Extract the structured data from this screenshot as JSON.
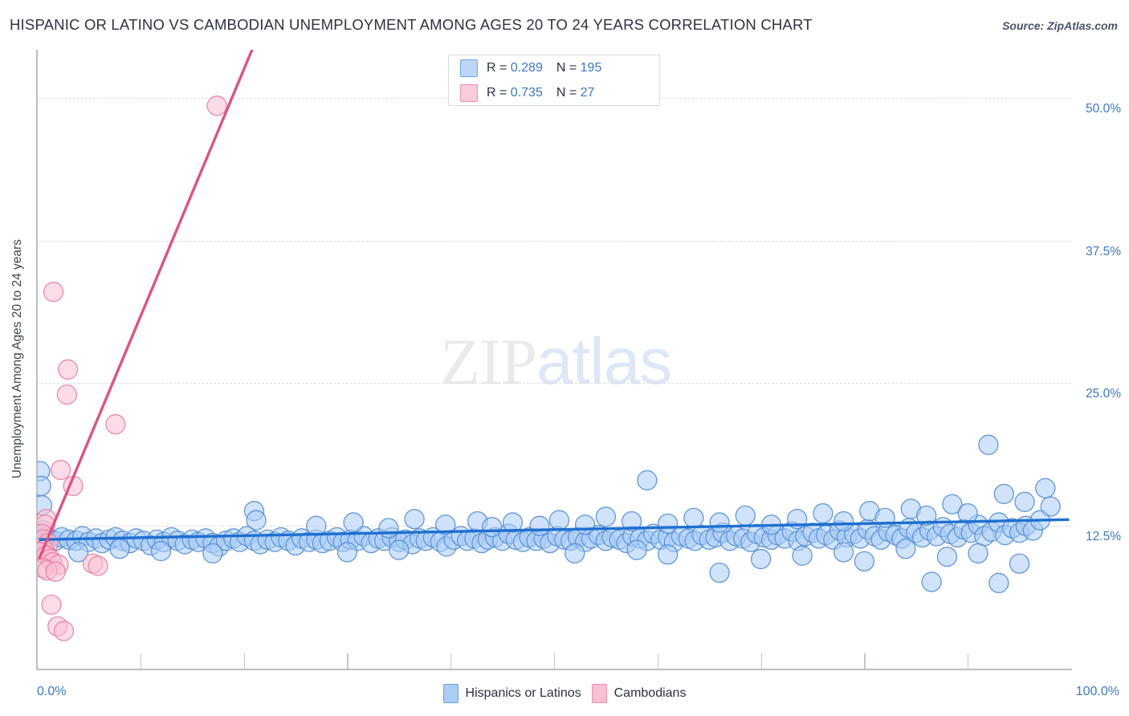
{
  "header": {
    "title": "HISPANIC OR LATINO VS CAMBODIAN UNEMPLOYMENT AMONG AGES 20 TO 24 YEARS CORRELATION CHART",
    "source": "Source: ZipAtlas.com"
  },
  "watermark": {
    "part1": "ZIP",
    "part2": "atlas"
  },
  "stats": {
    "rows": [
      {
        "series": "Hispanics or Latinos",
        "r_label": "R =",
        "r_value": "0.289",
        "n_label": "N =",
        "n_value": "195",
        "color": "#bdd6f7"
      },
      {
        "series": "Cambodians",
        "r_label": "R =",
        "r_value": "0.735",
        "n_label": "N =",
        "n_value": "27",
        "color": "#f9ccd9"
      }
    ]
  },
  "legend": {
    "items": [
      {
        "label": "Hispanics or Latinos",
        "color": "#aaccf5",
        "border": "#6fa3e0"
      },
      {
        "label": "Cambodians",
        "color": "#f9c0d2",
        "border": "#eb90ad"
      }
    ]
  },
  "chart_data": {
    "type": "scatter",
    "title": "HISPANIC OR LATINO VS CAMBODIAN UNEMPLOYMENT AMONG AGES 20 TO 24 YEARS CORRELATION CHART",
    "xlabel": "",
    "ylabel": "Unemployment Among Ages 20 to 24 years",
    "xlim": [
      0,
      100
    ],
    "ylim": [
      0,
      54.2
    ],
    "x_tick_labels": [
      "0.0%",
      "100.0%"
    ],
    "y_tick_labels": [
      "12.5%",
      "25.0%",
      "37.5%",
      "50.0%"
    ],
    "y_ticks": [
      12.5,
      25.0,
      37.5,
      50.0
    ],
    "grid": true,
    "legend_position": "bottom-center",
    "series": [
      {
        "name": "Hispanics or Latinos",
        "color": "#aaccf5",
        "border": "#4a87d3",
        "r": 0.289,
        "n": 195,
        "trend": {
          "x0": 0.2,
          "y0": 11.3,
          "x1": 99.8,
          "y1": 13.05,
          "color": "#1f6fd0"
        },
        "points": [
          [
            0.3,
            17.3
          ],
          [
            0.4,
            16.0
          ],
          [
            0.5,
            14.3
          ],
          [
            0.6,
            12.1
          ],
          [
            0.9,
            11.6
          ],
          [
            1.2,
            11.4
          ],
          [
            1.8,
            11.2
          ],
          [
            2.4,
            11.5
          ],
          [
            3.1,
            11.3
          ],
          [
            3.8,
            11.2
          ],
          [
            4.4,
            11.6
          ],
          [
            5.0,
            11.1
          ],
          [
            5.7,
            11.4
          ],
          [
            6.3,
            11.0
          ],
          [
            7.0,
            11.3
          ],
          [
            7.6,
            11.5
          ],
          [
            8.3,
            11.2
          ],
          [
            9.0,
            11.0
          ],
          [
            9.6,
            11.4
          ],
          [
            10.3,
            11.2
          ],
          [
            11.0,
            10.8
          ],
          [
            11.6,
            11.3
          ],
          [
            12.3,
            11.1
          ],
          [
            13.0,
            11.5
          ],
          [
            13.6,
            11.2
          ],
          [
            14.3,
            10.9
          ],
          [
            15.0,
            11.3
          ],
          [
            15.6,
            11.1
          ],
          [
            16.3,
            11.4
          ],
          [
            17.0,
            11.0
          ],
          [
            17.6,
            10.7
          ],
          [
            18.3,
            11.2
          ],
          [
            19.0,
            11.4
          ],
          [
            19.6,
            11.1
          ],
          [
            20.3,
            11.6
          ],
          [
            21.0,
            11.2
          ],
          [
            21.6,
            10.9
          ],
          [
            22.3,
            11.3
          ],
          [
            23.0,
            11.1
          ],
          [
            23.6,
            11.5
          ],
          [
            24.3,
            11.2
          ],
          [
            25.0,
            10.8
          ],
          [
            25.6,
            11.4
          ],
          [
            26.3,
            11.1
          ],
          [
            27.0,
            11.3
          ],
          [
            27.6,
            11.0
          ],
          [
            28.3,
            11.2
          ],
          [
            29.0,
            11.5
          ],
          [
            29.6,
            11.1
          ],
          [
            30.3,
            11.3
          ],
          [
            31.0,
            11.2
          ],
          [
            31.6,
            11.6
          ],
          [
            32.3,
            11.0
          ],
          [
            33.0,
            11.4
          ],
          [
            33.6,
            11.2
          ],
          [
            34.3,
            11.5
          ],
          [
            35.0,
            11.1
          ],
          [
            35.6,
            11.3
          ],
          [
            36.3,
            10.9
          ],
          [
            37.0,
            11.4
          ],
          [
            37.6,
            11.2
          ],
          [
            38.3,
            11.5
          ],
          [
            39.0,
            11.1
          ],
          [
            39.6,
            10.7
          ],
          [
            40.3,
            11.3
          ],
          [
            41.0,
            11.6
          ],
          [
            41.6,
            11.2
          ],
          [
            42.3,
            11.4
          ],
          [
            43.0,
            11.0
          ],
          [
            43.6,
            11.3
          ],
          [
            44.3,
            11.5
          ],
          [
            45.0,
            11.2
          ],
          [
            45.6,
            11.8
          ],
          [
            46.3,
            11.3
          ],
          [
            47.0,
            11.1
          ],
          [
            47.6,
            11.5
          ],
          [
            48.3,
            11.2
          ],
          [
            49.0,
            11.4
          ],
          [
            49.6,
            11.0
          ],
          [
            50.3,
            11.6
          ],
          [
            51.0,
            11.3
          ],
          [
            51.6,
            11.2
          ],
          [
            52.3,
            11.5
          ],
          [
            53.0,
            11.1
          ],
          [
            53.6,
            11.4
          ],
          [
            54.3,
            11.7
          ],
          [
            55.0,
            11.2
          ],
          [
            55.6,
            11.5
          ],
          [
            56.3,
            11.3
          ],
          [
            57.0,
            11.0
          ],
          [
            57.6,
            11.6
          ],
          [
            58.3,
            11.4
          ],
          [
            59.0,
            11.2
          ],
          [
            59.6,
            11.8
          ],
          [
            60.3,
            11.3
          ],
          [
            61.0,
            11.5
          ],
          [
            61.6,
            11.1
          ],
          [
            62.3,
            11.6
          ],
          [
            63.0,
            11.4
          ],
          [
            63.6,
            11.2
          ],
          [
            64.3,
            11.7
          ],
          [
            65.0,
            11.3
          ],
          [
            65.6,
            11.5
          ],
          [
            66.3,
            11.9
          ],
          [
            67.0,
            11.2
          ],
          [
            67.6,
            11.6
          ],
          [
            68.3,
            11.4
          ],
          [
            69.0,
            11.1
          ],
          [
            69.6,
            11.8
          ],
          [
            70.3,
            11.5
          ],
          [
            71.0,
            11.3
          ],
          [
            71.6,
            11.7
          ],
          [
            72.3,
            11.4
          ],
          [
            73.0,
            12.0
          ],
          [
            73.6,
            11.2
          ],
          [
            74.3,
            11.6
          ],
          [
            75.0,
            11.9
          ],
          [
            75.6,
            11.4
          ],
          [
            76.3,
            11.7
          ],
          [
            77.0,
            11.3
          ],
          [
            77.6,
            12.1
          ],
          [
            78.3,
            11.5
          ],
          [
            79.0,
            11.8
          ],
          [
            79.6,
            11.4
          ],
          [
            80.3,
            12.2
          ],
          [
            81.0,
            11.6
          ],
          [
            81.6,
            11.3
          ],
          [
            82.3,
            12.0
          ],
          [
            83.0,
            11.7
          ],
          [
            83.6,
            11.4
          ],
          [
            84.3,
            12.3
          ],
          [
            85.0,
            11.9
          ],
          [
            85.6,
            11.5
          ],
          [
            86.3,
            12.1
          ],
          [
            87.0,
            11.6
          ],
          [
            87.6,
            12.4
          ],
          [
            88.3,
            11.8
          ],
          [
            89.0,
            11.5
          ],
          [
            89.6,
            12.2
          ],
          [
            90.3,
            11.9
          ],
          [
            91.0,
            12.6
          ],
          [
            91.6,
            11.6
          ],
          [
            92.3,
            12.0
          ],
          [
            93.0,
            12.8
          ],
          [
            93.6,
            11.7
          ],
          [
            94.3,
            12.3
          ],
          [
            95.0,
            11.9
          ],
          [
            95.6,
            12.5
          ],
          [
            96.3,
            12.1
          ],
          [
            97.0,
            13.0
          ],
          [
            21.0,
            13.8
          ],
          [
            21.2,
            13.0
          ],
          [
            27.0,
            12.5
          ],
          [
            30.6,
            12.8
          ],
          [
            34.0,
            12.3
          ],
          [
            36.5,
            13.1
          ],
          [
            39.5,
            12.6
          ],
          [
            42.6,
            12.9
          ],
          [
            44.0,
            12.4
          ],
          [
            46.0,
            12.8
          ],
          [
            48.6,
            12.5
          ],
          [
            50.5,
            13.0
          ],
          [
            53.0,
            12.6
          ],
          [
            55.0,
            13.3
          ],
          [
            57.5,
            12.9
          ],
          [
            59.0,
            16.5
          ],
          [
            61.0,
            12.7
          ],
          [
            63.5,
            13.2
          ],
          [
            66.0,
            12.8
          ],
          [
            68.5,
            13.4
          ],
          [
            71.0,
            12.6
          ],
          [
            73.5,
            13.1
          ],
          [
            76.0,
            13.6
          ],
          [
            78.0,
            12.9
          ],
          [
            80.5,
            13.8
          ],
          [
            82.0,
            13.2
          ],
          [
            84.5,
            14.0
          ],
          [
            86.0,
            13.4
          ],
          [
            88.5,
            14.4
          ],
          [
            90.0,
            13.6
          ],
          [
            92.0,
            19.6
          ],
          [
            93.5,
            15.3
          ],
          [
            95.5,
            14.6
          ],
          [
            97.5,
            15.8
          ],
          [
            98.0,
            14.2
          ],
          [
            61.0,
            10.0
          ],
          [
            66.0,
            8.4
          ],
          [
            70.0,
            9.6
          ],
          [
            74.0,
            9.9
          ],
          [
            78.0,
            10.2
          ],
          [
            80.0,
            9.4
          ],
          [
            84.0,
            10.5
          ],
          [
            86.5,
            7.6
          ],
          [
            88.0,
            9.8
          ],
          [
            91.0,
            10.1
          ],
          [
            93.0,
            7.5
          ],
          [
            95.0,
            9.2
          ],
          [
            30.0,
            10.2
          ],
          [
            35.0,
            10.4
          ],
          [
            12.0,
            10.3
          ],
          [
            17.0,
            10.1
          ],
          [
            8.0,
            10.5
          ],
          [
            4.0,
            10.2
          ],
          [
            58.0,
            10.4
          ],
          [
            52.0,
            10.1
          ]
        ]
      },
      {
        "name": "Cambodians",
        "color": "#f9c0d2",
        "border": "#e8799f",
        "r": 0.735,
        "n": 27,
        "trend": {
          "x0": 0.2,
          "y0": 9.6,
          "x1": 20.8,
          "y1": 54.2,
          "color": "#e05184"
        },
        "points": [
          [
            17.4,
            49.3
          ],
          [
            1.6,
            33.0
          ],
          [
            3.0,
            26.2
          ],
          [
            2.9,
            24.0
          ],
          [
            7.6,
            21.4
          ],
          [
            2.3,
            17.4
          ],
          [
            3.5,
            16.0
          ],
          [
            0.9,
            13.1
          ],
          [
            0.8,
            12.6
          ],
          [
            0.5,
            11.8
          ],
          [
            0.6,
            11.3
          ],
          [
            1.1,
            11.0
          ],
          [
            0.4,
            10.6
          ],
          [
            0.7,
            10.4
          ],
          [
            0.3,
            10.2
          ],
          [
            0.9,
            9.9
          ],
          [
            1.3,
            9.6
          ],
          [
            1.5,
            9.3
          ],
          [
            2.1,
            9.1
          ],
          [
            5.4,
            9.2
          ],
          [
            5.9,
            9.0
          ],
          [
            0.6,
            8.8
          ],
          [
            1.0,
            8.6
          ],
          [
            1.8,
            8.5
          ],
          [
            1.4,
            5.6
          ],
          [
            2.0,
            3.7
          ],
          [
            2.6,
            3.3
          ]
        ]
      }
    ]
  }
}
